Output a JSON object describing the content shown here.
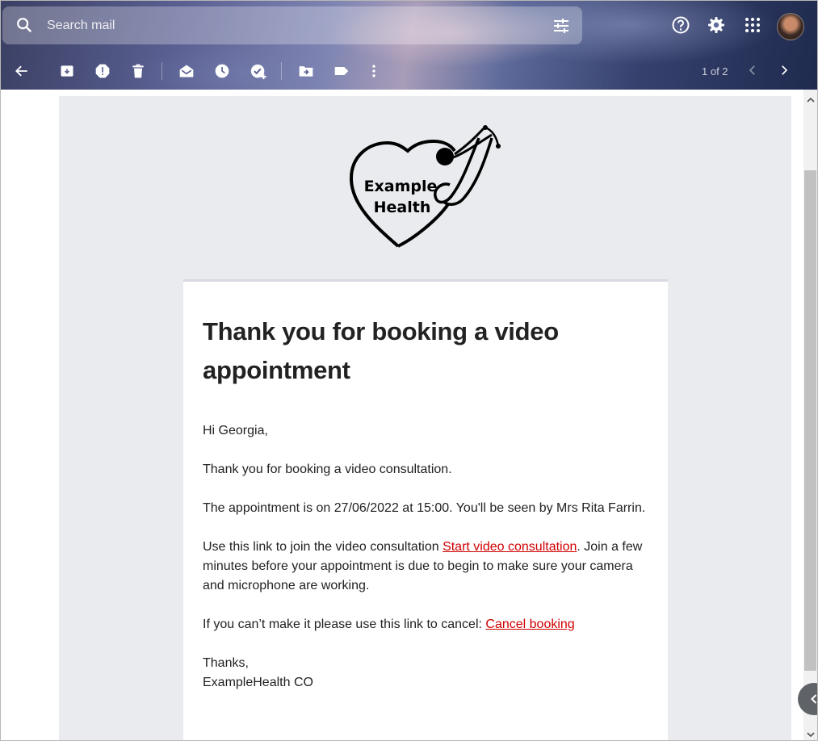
{
  "search": {
    "placeholder": "Search mail"
  },
  "pager": {
    "text": "1 of 2"
  },
  "logo": {
    "line1": "Example",
    "line2": "Health"
  },
  "email": {
    "title": "Thank you for booking a video appointment",
    "greeting": "Hi Georgia,",
    "p1": "Thank you for booking a video consultation.",
    "p2": "The appointment is on 27/06/2022 at 15:00. You'll be seen by Mrs Rita Farrin.",
    "p3_prefix": "Use this link to join the video consultation ",
    "p3_link": "Start video consultation",
    "p3_suffix": ". Join a few minutes before your appointment is due to begin to make sure your camera and microphone are working.",
    "p4_prefix": "If you can’t make it please use this link to cancel: ",
    "p4_link": "Cancel booking",
    "sign1": "Thanks,",
    "sign2": "ExampleHealth CO"
  },
  "colors": {
    "link": "#d00000",
    "mail_background": "#e9ebee"
  }
}
